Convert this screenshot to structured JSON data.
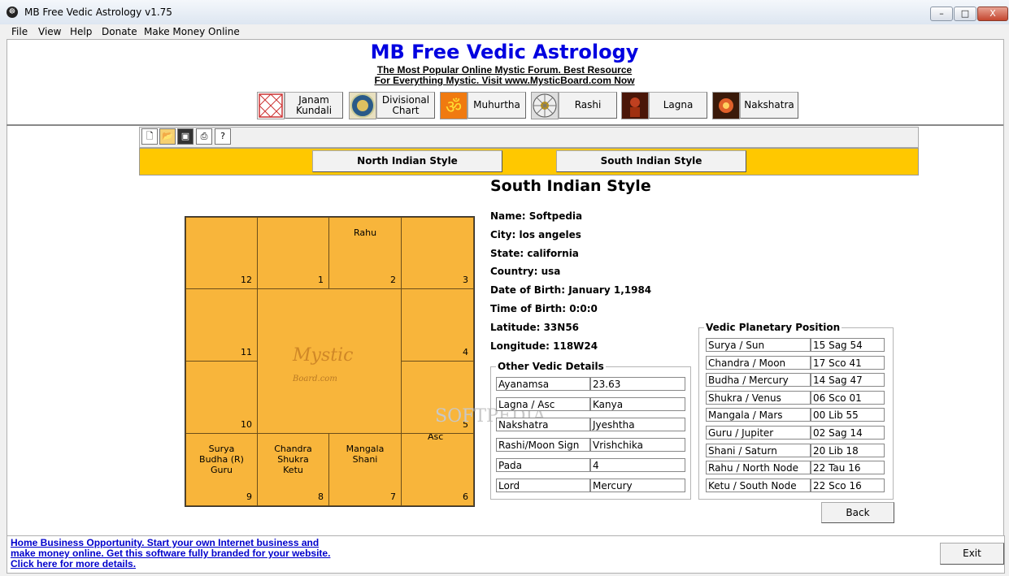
{
  "window": {
    "title": "MB Free Vedic Astrology v1.75",
    "minimize": "–",
    "maximize": "□",
    "close": "X"
  },
  "menu": [
    "File",
    "View",
    "Help",
    "Donate",
    "Make Money Online"
  ],
  "header": {
    "app_title": "MB Free Vedic Astrology",
    "promo_line1": "The Most Popular Online Mystic Forum. Best Resource",
    "promo_line2": "For Everything Mystic. Visit www.MysticBoard.com Now"
  },
  "nav": [
    {
      "label": "Janam\nKundali",
      "icon": "janam-kundali-icon"
    },
    {
      "label": "Divisional\nChart",
      "icon": "divisional-chart-icon"
    },
    {
      "label": "Muhurtha",
      "icon": "om-icon"
    },
    {
      "label": "Rashi",
      "icon": "rashi-wheel-icon"
    },
    {
      "label": "Lagna",
      "icon": "lagna-icon"
    },
    {
      "label": "Nakshatra",
      "icon": "nakshatra-icon"
    }
  ],
  "toolbar": {
    "icons": [
      "new-file-icon",
      "open-folder-icon",
      "save-icon",
      "print-icon",
      "help-pointer-icon"
    ]
  },
  "style_buttons": {
    "north": "North Indian Style",
    "south": "South Indian Style"
  },
  "section_title": "South Indian Style",
  "birth_info": [
    "Name: Softpedia",
    "City: los angeles",
    "State: california",
    "Country: usa",
    "Date of Birth: January 1,1984",
    "Time of Birth: 0:0:0",
    "Latitude: 33N56",
    "Longitude: 118W24"
  ],
  "chart": {
    "cells": {
      "c12": {
        "num": "12",
        "text": ""
      },
      "c1": {
        "num": "1",
        "text": ""
      },
      "c2": {
        "num": "2",
        "text": "Rahu"
      },
      "c3": {
        "num": "3",
        "text": ""
      },
      "c11": {
        "num": "11",
        "text": ""
      },
      "c4": {
        "num": "4",
        "text": ""
      },
      "c10": {
        "num": "10",
        "text": ""
      },
      "c5": {
        "num": "5",
        "text": "Asc"
      },
      "c9": {
        "num": "9",
        "text": "Surya\nBudha (R)\nGuru"
      },
      "c8": {
        "num": "8",
        "text": "Chandra\nShukra\nKetu"
      },
      "c7": {
        "num": "7",
        "text": "Mangala\nShani"
      },
      "c6": {
        "num": "6",
        "text": ""
      }
    },
    "watermark": "Mystic",
    "watermark_sub": "Board.com"
  },
  "other_details": {
    "title": "Other Vedic Details",
    "rows": [
      [
        "Ayanamsa",
        "23.63"
      ],
      [
        "Lagna / Asc",
        "Kanya"
      ],
      [
        "Nakshatra",
        "Jyeshtha"
      ],
      [
        "Rashi/Moon Sign",
        "Vrishchika"
      ],
      [
        "Pada",
        "4"
      ],
      [
        "Lord",
        "Mercury"
      ]
    ]
  },
  "planetary": {
    "title": "Vedic Planetary Position",
    "rows": [
      [
        "Surya / Sun",
        "15 Sag 54"
      ],
      [
        "Chandra / Moon",
        "17 Sco 41"
      ],
      [
        "Budha / Mercury",
        "14 Sag 47"
      ],
      [
        "Shukra / Venus",
        "06 Sco 01"
      ],
      [
        "Mangala / Mars",
        "00 Lib 55"
      ],
      [
        "Guru / Jupiter",
        "02 Sag 14"
      ],
      [
        "Shani / Saturn",
        "20 Lib 18"
      ],
      [
        "Rahu / North Node",
        "22 Tau 16"
      ],
      [
        "Ketu / South Node",
        "22 Sco 16"
      ]
    ]
  },
  "buttons": {
    "back": "Back",
    "exit": "Exit"
  },
  "footer": {
    "link_line1": "Home Business Opportunity. Start your own Internet business and",
    "link_line2": "make money online. Get this software fully branded for your website.",
    "link_line3": "Click here for more details."
  },
  "watermark_text": "SOFTPEDIA",
  "colors": {
    "chart_bg": "#f8b53b",
    "orange_bar": "#ffc800",
    "title_blue": "#0000e0",
    "link_blue": "#0000cc"
  }
}
